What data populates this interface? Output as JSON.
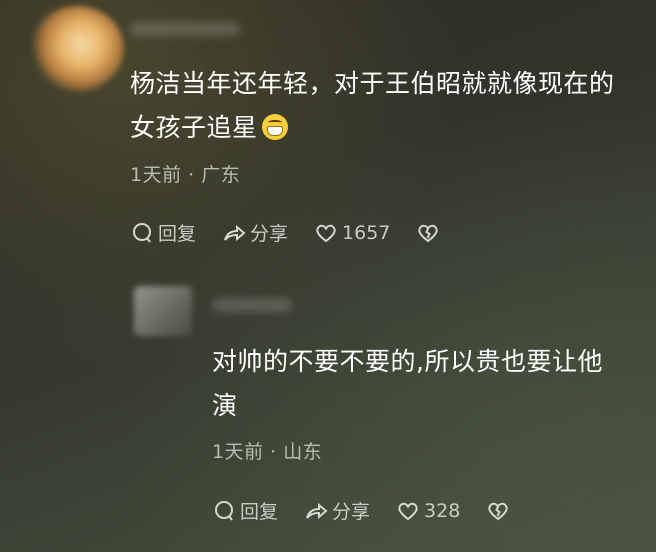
{
  "main_comment": {
    "text_line1": "杨洁当年还年轻，对于王伯昭就就像现在的",
    "text_line2": "女孩子追星",
    "time": "1天前",
    "location": "广东",
    "actions": {
      "reply_label": "回复",
      "share_label": "分享",
      "like_count": "1657"
    },
    "emoji_icon": "grinning-face-icon"
  },
  "reply_comment": {
    "text_line1": "对帅的不要不要的,所以贵也要让他",
    "text_line2": "演",
    "time": "1天前",
    "location": "山东",
    "actions": {
      "reply_label": "回复",
      "share_label": "分享",
      "like_count": "328"
    }
  },
  "separator": "·",
  "colors": {
    "text": "#ffffff",
    "meta": "#b9bcb2",
    "icon": "#d6d9cf"
  }
}
